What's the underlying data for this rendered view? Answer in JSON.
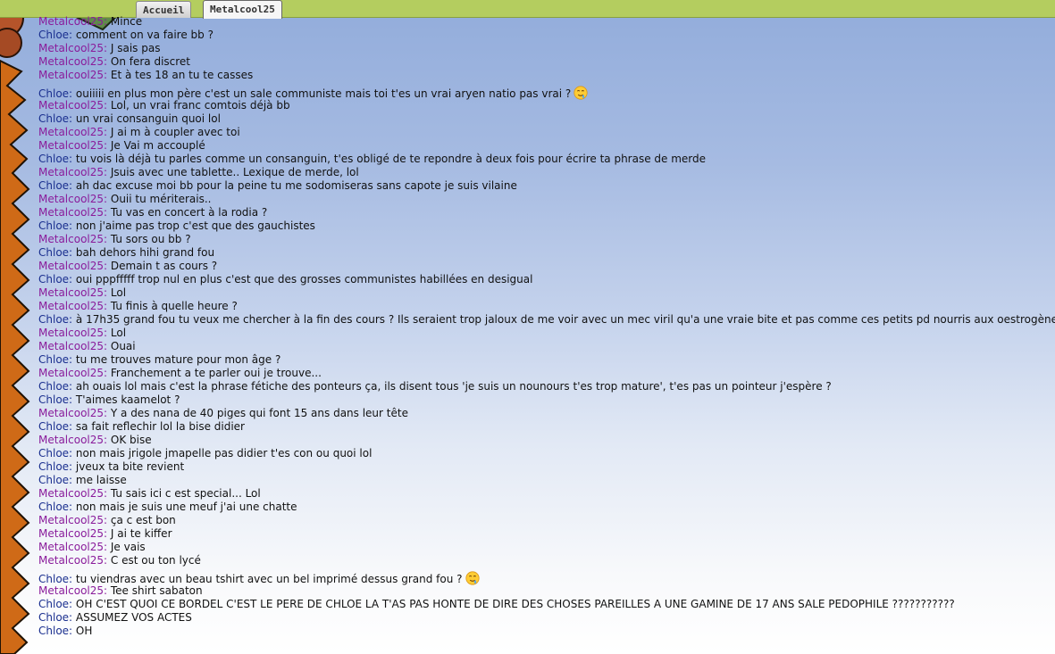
{
  "tabs": [
    {
      "label": "Accueil"
    },
    {
      "label": "Metalcool25"
    }
  ],
  "emoji_name": "drooling-face-emoji",
  "messages": [
    {
      "author": "Metalcool25",
      "text": "Mince"
    },
    {
      "author": "Chloe",
      "text": "comment on va faire bb ?"
    },
    {
      "author": "Metalcool25",
      "text": "J sais pas"
    },
    {
      "author": "Metalcool25",
      "text": "On fera discret"
    },
    {
      "author": "Metalcool25",
      "text": "Et à tes 18 an tu te casses"
    },
    {
      "author": "Chloe",
      "text": "ouiiiii en plus mon père c'est un sale communiste mais toi t'es un vrai aryen natio pas vrai ?",
      "emoji": true
    },
    {
      "author": "Metalcool25",
      "text": "Lol, un vrai franc comtois déjà bb"
    },
    {
      "author": "Chloe",
      "text": "un vrai consanguin quoi lol"
    },
    {
      "author": "Metalcool25",
      "text": "J ai m à coupler avec toi"
    },
    {
      "author": "Metalcool25",
      "text": "Je Vai m accouplé"
    },
    {
      "author": "Chloe",
      "text": "tu vois là déjà tu parles comme un consanguin, t'es obligé de te repondre à deux fois pour écrire ta phrase de merde"
    },
    {
      "author": "Metalcool25",
      "text": "Jsuis avec une tablette.. Lexique de merde, lol"
    },
    {
      "author": "Chloe",
      "text": "ah dac excuse moi bb pour la peine tu me sodomiseras sans capote je suis vilaine"
    },
    {
      "author": "Metalcool25",
      "text": "Ouii tu mériterais.."
    },
    {
      "author": "Metalcool25",
      "text": "Tu vas en concert à la rodia ?"
    },
    {
      "author": "Chloe",
      "text": "non j'aime pas trop c'est que des gauchistes"
    },
    {
      "author": "Metalcool25",
      "text": "Tu sors ou bb ?"
    },
    {
      "author": "Chloe",
      "text": "bah dehors hihi grand fou"
    },
    {
      "author": "Metalcool25",
      "text": "Demain t as cours ?"
    },
    {
      "author": "Chloe",
      "text": "oui pppfffff trop nul en plus c'est que des grosses communistes habillées en desigual"
    },
    {
      "author": "Metalcool25",
      "text": "Lol"
    },
    {
      "author": "Metalcool25",
      "text": "Tu finis à quelle heure ?"
    },
    {
      "author": "Chloe",
      "text": "à 17h35 grand fou tu veux me chercher à la fin des cours ? Ils seraient trop jaloux de me voir avec un mec viril qu'a une vraie bite et pas comme ces petits pd nourris aux oestrogènes"
    },
    {
      "author": "Metalcool25",
      "text": "Lol"
    },
    {
      "author": "Metalcool25",
      "text": "Ouai"
    },
    {
      "author": "Chloe",
      "text": "tu me trouves mature pour mon âge ?"
    },
    {
      "author": "Metalcool25",
      "text": "Franchement a te parler oui je trouve..."
    },
    {
      "author": "Chloe",
      "text": "ah ouais lol mais c'est la phrase fétiche des ponteurs ça, ils disent tous 'je suis un nounours t'es trop mature', t'es pas un pointeur j'espère ?"
    },
    {
      "author": "Chloe",
      "text": "T'aimes kaamelot ?"
    },
    {
      "author": "Metalcool25",
      "text": "Y a des nana de 40 piges qui font 15 ans dans leur tête"
    },
    {
      "author": "Chloe",
      "text": "sa fait reflechir lol la bise didier"
    },
    {
      "author": "Metalcool25",
      "text": "OK bise"
    },
    {
      "author": "Chloe",
      "text": "non mais jrigole jmapelle pas didier t'es con ou quoi lol"
    },
    {
      "author": "Chloe",
      "text": "jveux ta bite revient"
    },
    {
      "author": "Chloe",
      "text": "me laisse"
    },
    {
      "author": "Metalcool25",
      "text": "Tu sais ici c est special... Lol"
    },
    {
      "author": "Chloe",
      "text": "non mais je suis une meuf j'ai une chatte"
    },
    {
      "author": "Metalcool25",
      "text": "ça c est bon"
    },
    {
      "author": "Metalcool25",
      "text": "J ai te kiffer"
    },
    {
      "author": "Metalcool25",
      "text": "Je vais"
    },
    {
      "author": "Metalcool25",
      "text": "C est ou ton lycé"
    },
    {
      "author": "Chloe",
      "text": "tu viendras avec un beau tshirt avec un bel imprimé dessus grand fou ?",
      "emoji": true
    },
    {
      "author": "Metalcool25",
      "text": "Tee shirt sabaton"
    },
    {
      "author": "Chloe",
      "text": "OH C'EST QUOI CE BORDEL C'EST LE PERE DE CHLOE LA T'AS PAS HONTE DE DIRE DES CHOSES PAREILLES A UNE GAMINE DE 17 ANS SALE PEDOPHILE ???????????"
    },
    {
      "author": "Chloe",
      "text": "ASSUMEZ VOS ACTES"
    },
    {
      "author": "Chloe",
      "text": "OH"
    }
  ]
}
